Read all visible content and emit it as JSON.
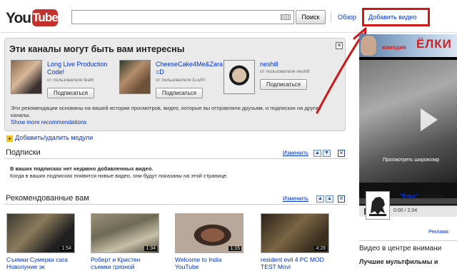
{
  "header": {
    "logo_you": "You",
    "logo_tube": "Tube",
    "search_button": "Поиск",
    "browse_link": "Обзор",
    "upload_link": "Добавить видео"
  },
  "recommendations": {
    "title": "Эти каналы могут быть вам интересны",
    "channels": [
      {
        "name": "Long Live Production Code!",
        "by": "от пользователя fealh",
        "button": "Подписаться"
      },
      {
        "name": "CheeseCake4Me&Zara =D",
        "by": "от пользователя iLuvPr",
        "button": "Подписаться"
      },
      {
        "name": "neshill",
        "by": "от пользователя neshill",
        "button": "Подписаться"
      }
    ],
    "note": "Эти рекомендации основаны на вашей истории просмотров, видео, которые вы отправляли друзьям, и подписках на другие каналы.",
    "show_more": "Show more recommendations"
  },
  "add_modules": "Добавить/удалить модули",
  "subscriptions": {
    "title": "Подписки",
    "edit": "Изменить",
    "empty_bold": "В ваших подписках нет недавно добавленных видео.",
    "empty_text": "Когда в ваших подписках появятся новые видео, они будут показаны на этой странице."
  },
  "recommended": {
    "title": "Рекомендованные вам",
    "edit": "Изменить",
    "videos": [
      {
        "title": "Съемки Сумерки сага Новолуние эк",
        "duration": "1:54"
      },
      {
        "title": "Роберт и Кристен съемки грязной",
        "duration": "1:34"
      },
      {
        "title": "Welcome to India YouTube",
        "duration": "1:15"
      },
      {
        "title": "resident evil 4 PC MOD TEST Movi",
        "duration": "4:28"
      }
    ]
  },
  "sidebar": {
    "ad_comedy": "комедия",
    "ad_title": "ЁЛКИ",
    "ad_caption": "Просмотреть широкоэкр",
    "player_time": "0:00 / 2:34",
    "trailer_link": "\"Ёлки\"",
    "trailer_suffix": " - трейлер",
    "ad_label": "Реклама",
    "featured_heading": "Видео в центре внимани",
    "best_heading": "Лучшие мультфильмы и"
  }
}
